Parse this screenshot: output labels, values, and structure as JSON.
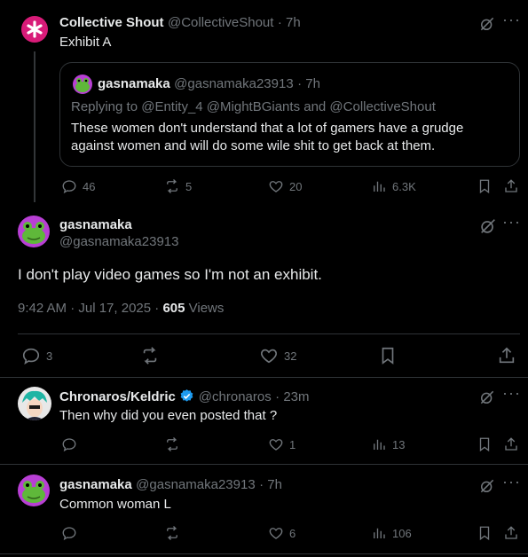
{
  "colors": {
    "background": "#000000",
    "text": "#e7e9ea",
    "muted": "#71767b",
    "border": "#2f3336",
    "verified": "#1d9bf0",
    "cs_logo": "#d81b78"
  },
  "tweet1": {
    "name": "Collective Shout",
    "handle": "@CollectiveShout",
    "time": "· 7h",
    "text": "Exhibit A",
    "quote": {
      "name": "gasnamaka",
      "handle": "@gasnamaka23913",
      "time": "· 7h",
      "replying": "Replying to @Entity_4 @MightBGiants and @CollectiveShout",
      "text": "These women don't understand that a lot of gamers have a grudge against women and will do some wile shit to get back at them."
    },
    "actions": {
      "replies": "46",
      "reposts": "5",
      "likes": "20",
      "views": "6.3K"
    }
  },
  "main": {
    "name": "gasnamaka",
    "handle": "@gasnamaka23913",
    "text": "I don't play video games so I'm not an exhibit.",
    "meta_time": "9:42 AM · Jul 17, 2025 · ",
    "views_count": "605",
    "views_label": " Views",
    "actions": {
      "replies": "3",
      "likes": "32"
    }
  },
  "reply1": {
    "name": "Chronaros/Keldric",
    "handle": "@chronaros",
    "time": "· 23m",
    "text": "Then why did you even posted that ?",
    "actions": {
      "likes": "1",
      "views": "13"
    }
  },
  "reply2": {
    "name": "gasnamaka",
    "handle": "@gasnamaka23913",
    "time": "· 7h",
    "text": "Common woman L",
    "actions": {
      "likes": "6",
      "views": "106"
    }
  },
  "icons": [
    "grok-icon",
    "more-icon",
    "reply-icon",
    "repost-icon",
    "like-icon",
    "views-icon",
    "bookmark-icon",
    "share-icon",
    "verified-icon"
  ]
}
